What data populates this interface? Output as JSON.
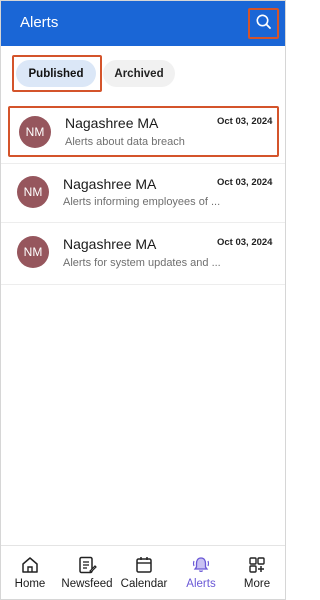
{
  "header": {
    "title": "Alerts",
    "search_icon": "search-icon"
  },
  "tabs": [
    {
      "label": "Published",
      "active": true
    },
    {
      "label": "Archived",
      "active": false
    }
  ],
  "alerts": [
    {
      "initials": "NM",
      "name": "Nagashree MA",
      "date": "Oct 03, 2024",
      "description": "Alerts about data breach"
    },
    {
      "initials": "NM",
      "name": "Nagashree MA",
      "date": "Oct 03, 2024",
      "description": "Alerts informing employees of ..."
    },
    {
      "initials": "NM",
      "name": "Nagashree MA",
      "date": "Oct 03, 2024",
      "description": "Alerts for system updates and ..."
    }
  ],
  "nav": [
    {
      "label": "Home",
      "icon": "home-icon"
    },
    {
      "label": "Newsfeed",
      "icon": "newsfeed-icon"
    },
    {
      "label": "Calendar",
      "icon": "calendar-icon"
    },
    {
      "label": "Alerts",
      "icon": "bell-icon",
      "active": true
    },
    {
      "label": "More",
      "icon": "more-icon"
    }
  ],
  "colors": {
    "header_bg": "#1a66d6",
    "avatar_bg": "#96565d",
    "active_tab_bg": "#dbe7f7",
    "highlight_outline": "#d4542b",
    "nav_active": "#6a58d6"
  }
}
